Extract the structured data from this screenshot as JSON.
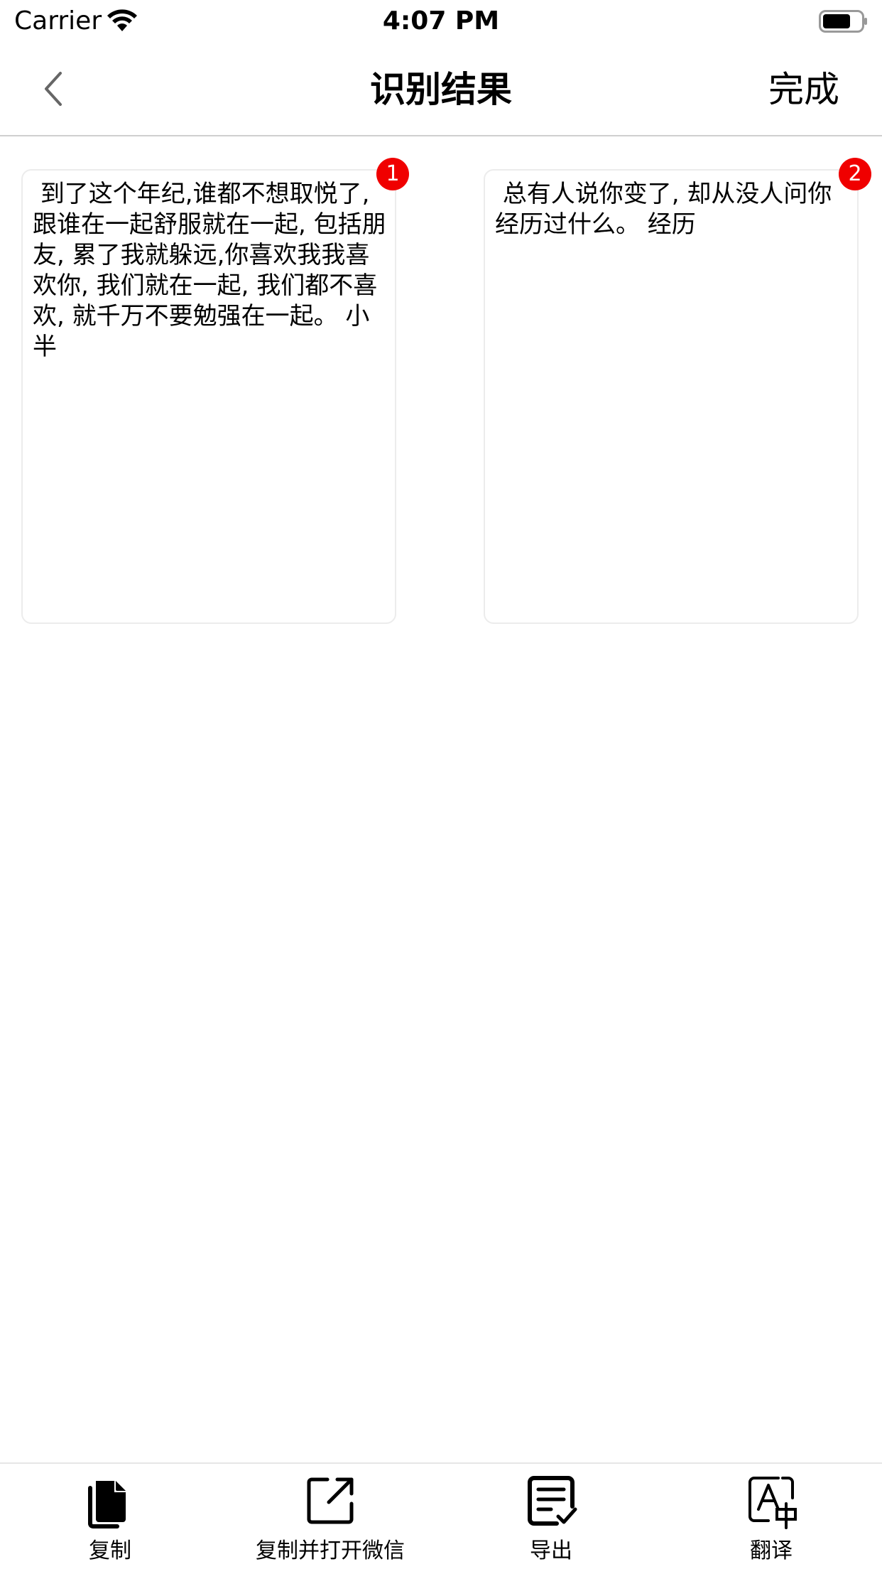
{
  "status_bar": {
    "carrier": "Carrier",
    "time": "4:07 PM"
  },
  "nav": {
    "title": "识别结果",
    "done_label": "完成"
  },
  "results": [
    {
      "index": "1",
      "text": " 到了这个年纪,谁都不想取悦了, 跟谁在一起舒服就在一起, 包括朋友, 累了我就躲远,你喜欢我我喜欢你, 我们就在一起, 我们都不喜欢, 就千万不要勉强在一起。 小半"
    },
    {
      "index": "2",
      "text": " 总有人说你变了, 却从没人问你经历过什么。 经历"
    }
  ],
  "toolbar": {
    "copy_label": "复制",
    "copy_open_wechat_label": "复制并打开微信",
    "export_label": "导出",
    "translate_label": "翻译"
  },
  "colors": {
    "badge": "#f00000",
    "divider": "#cfcfcf",
    "card_border": "#ececec"
  }
}
